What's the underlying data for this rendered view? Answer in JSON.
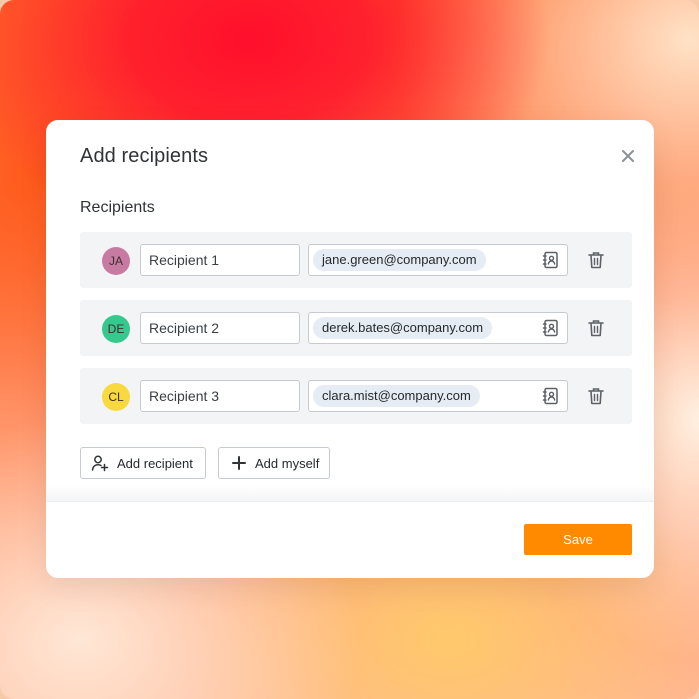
{
  "dialog": {
    "title": "Add recipients",
    "section_label": "Recipients",
    "recipients": [
      {
        "initials": "JA",
        "avatar_color": "#c77ba3",
        "name": "Recipient 1",
        "email": "jane.green@company.com"
      },
      {
        "initials": "DE",
        "avatar_color": "#36c98e",
        "name": "Recipient 2",
        "email": "derek.bates@company.com"
      },
      {
        "initials": "CL",
        "avatar_color": "#f8d93e",
        "name": "Recipient 3",
        "email": "clara.mist@company.com"
      }
    ],
    "add_recipient_label": "Add recipient",
    "add_myself_label": "Add myself",
    "save_label": "Save"
  },
  "colors": {
    "accent": "#ff8a00",
    "row_background": "#f3f4f6",
    "chip_background": "#e6ecf3"
  },
  "icons": [
    "close-icon",
    "contacts-book-icon",
    "trash-icon",
    "add-user-icon",
    "plus-icon"
  ]
}
